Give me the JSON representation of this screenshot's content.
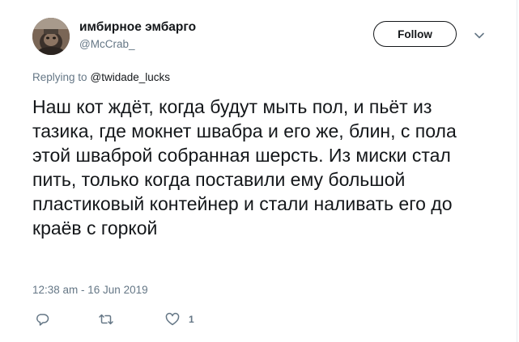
{
  "tweet": {
    "author": {
      "display_name": "имбирное эмбарго",
      "handle": "@McCrab_",
      "avatar_icon": "cat-photo-avatar"
    },
    "follow_label": "Follow",
    "menu_icon": "chevron-down-icon",
    "replying_prefix": "Replying to",
    "replying_to": "@twidade_lucks",
    "text": "Наш кот ждёт, когда будут мыть пол, и пьёт из тазика, где мокнет швабра и его же, блин, с пола этой шваброй собранная шерсть. Из миски стал пить, только когда поставили ему большой пластиковый контейнер и стали наливать его до краёв с горкой",
    "timestamp": "12:38 am - 16 Jun 2019",
    "actions": {
      "reply_icon": "reply-icon",
      "retweet_icon": "retweet-icon",
      "like_icon": "heart-icon",
      "like_count": "1"
    }
  },
  "colors": {
    "text_primary": "#14171a",
    "text_secondary": "#657786",
    "border": "#e6ecf0"
  }
}
